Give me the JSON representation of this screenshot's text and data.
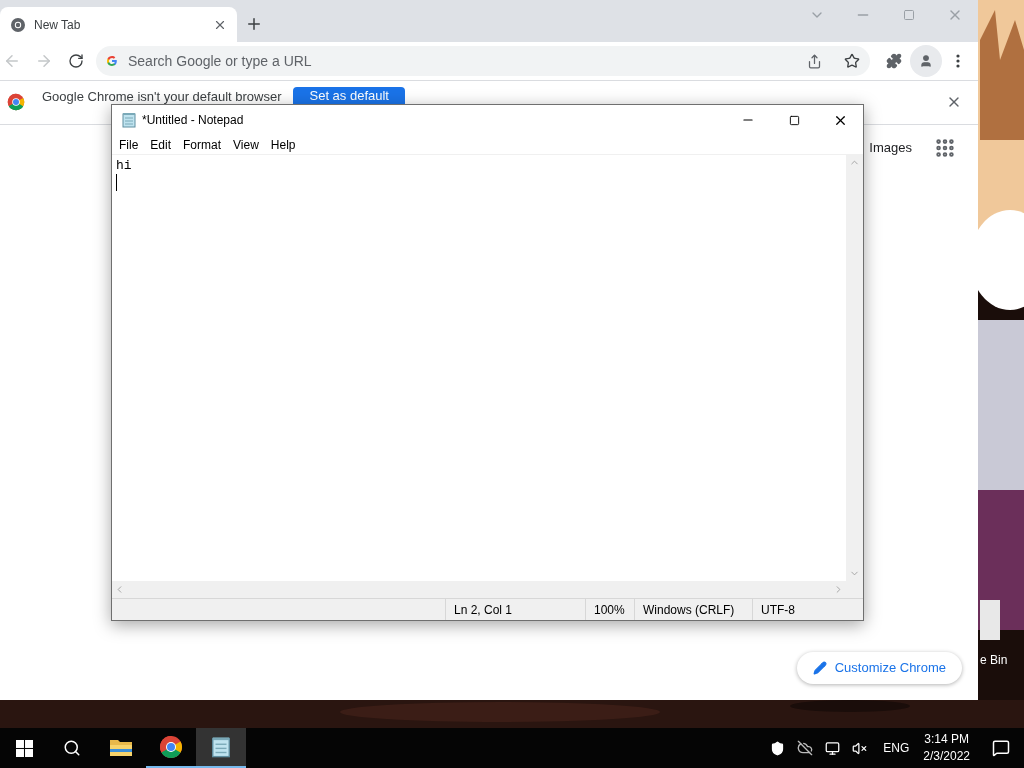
{
  "browser": {
    "tab": {
      "title": "New Tab",
      "selected": true
    },
    "address_bar": {
      "placeholder": "Search Google or type a URL"
    },
    "infobar": {
      "message": "Google Chrome isn't your default browser",
      "button": "Set as default"
    },
    "header_links": [
      "Images"
    ],
    "customize_button": "Customize Chrome"
  },
  "notepad": {
    "title": "*Untitled - Notepad",
    "menu": [
      "File",
      "Edit",
      "Format",
      "View",
      "Help"
    ],
    "content": "hi",
    "status": [
      "Ln 2, Col 1",
      "100%",
      "Windows (CRLF)",
      "UTF-8"
    ]
  },
  "desktop": {
    "icons": [
      {
        "label": "e Bin"
      }
    ]
  },
  "taskbar": {
    "apps": [
      {
        "kind": "files",
        "running": false,
        "selected": false
      },
      {
        "kind": "chrome",
        "running": true,
        "selected": false
      },
      {
        "kind": "notepad",
        "running": true,
        "selected": true
      }
    ],
    "language": "ENG",
    "time": "3:14 PM",
    "date": "2/3/2022"
  }
}
